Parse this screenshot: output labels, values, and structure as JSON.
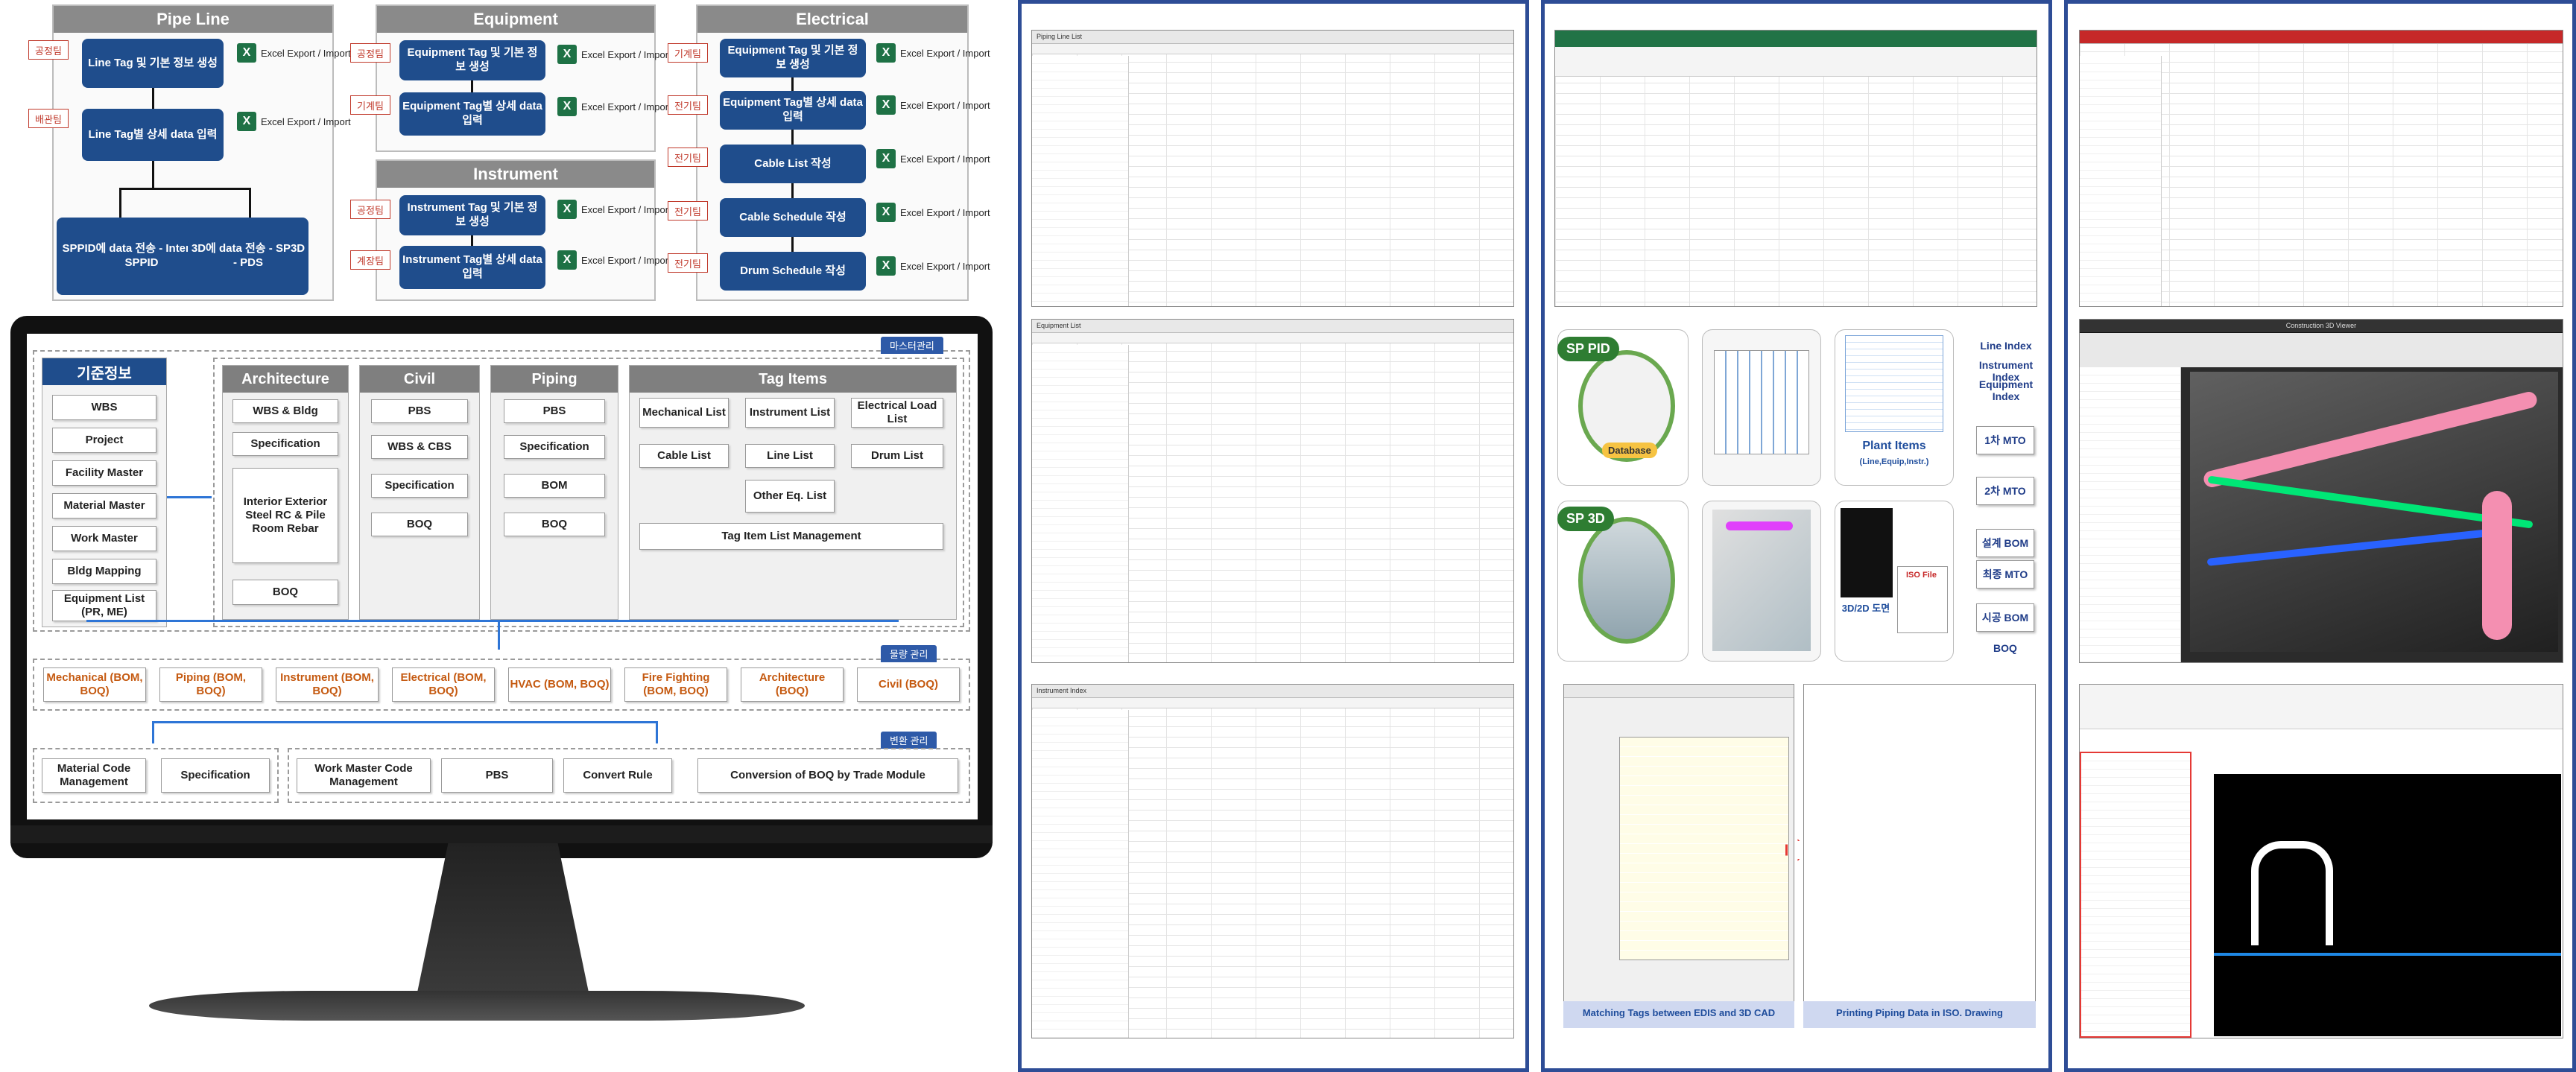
{
  "pipeline": {
    "title": "Pipe Line",
    "tag1": "공정팀",
    "tag2": "배관팀",
    "box1": "Line Tag 및 기본 정보 생성",
    "box2": "Line Tag별 상세 data 입력",
    "box3": "SPPID에 data 전송 - Intergraph SPPID",
    "box4": "3D에 data 전송 - SP3D - PDS",
    "xl_label": "Excel Export / Import"
  },
  "equipment": {
    "title": "Equipment",
    "tag1": "공정팀",
    "tag2": "기계팀",
    "box1": "Equipment Tag 및 기본 정보 생성",
    "box2": "Equipment Tag별 상세 data 입력",
    "xl_label": "Excel Export / Import"
  },
  "instrument": {
    "title": "Instrument",
    "tag1": "공정팀",
    "tag2": "계장팀",
    "box1": "Instrument Tag 및 기본 정보 생성",
    "box2": "Instrument Tag별 상세 data 입력",
    "xl_label": "Excel Export / Import"
  },
  "electrical": {
    "title": "Electrical",
    "tags": [
      "기계팀",
      "전기팀",
      "전기팀",
      "전기팀",
      "전기팀"
    ],
    "boxes": [
      "Equipment Tag 및 기본 정보 생성",
      "Equipment Tag별 상세 data 입력",
      "Cable List 작성",
      "Cable Schedule 작성",
      "Drum Schedule 작성"
    ],
    "xl_label": "Excel Export / Import"
  },
  "monitor": {
    "badge_master": "마스터관리",
    "badge_material": "물량 관리",
    "badge_change": "변환 관리",
    "basic": {
      "title": "기준정보",
      "items": [
        "WBS",
        "Project",
        "Facility Master",
        "Material Master",
        "Work Master",
        "Bldg Mapping",
        "Equipment List (PR, ME)"
      ]
    },
    "architecture": {
      "title": "Architecture",
      "items": [
        "WBS & Bldg",
        "Specification",
        "Interior Exterior Steel RC & Pile Room Rebar",
        "BOQ"
      ]
    },
    "civil": {
      "title": "Civil",
      "items": [
        "PBS",
        "WBS & CBS",
        "Specification",
        "BOQ"
      ]
    },
    "piping": {
      "title": "Piping",
      "items": [
        "PBS",
        "Specification",
        "BOM",
        "BOQ"
      ]
    },
    "tagitems": {
      "title": "Tag Items",
      "items": [
        "Mechanical List",
        "Instrument List",
        "Electrical Load List",
        "Cable List",
        "Line List",
        "Drum List",
        "Other Eq. List"
      ],
      "footer": "Tag Item List Management"
    },
    "trades": [
      "Mechanical (BOM, BOQ)",
      "Piping (BOM, BOQ)",
      "Instrument (BOM, BOQ)",
      "Electrical (BOM, BOQ)",
      "HVAC (BOM, BOQ)",
      "Fire Fighting (BOM, BOQ)",
      "Architecture (BOQ)",
      "Civil (BOQ)"
    ],
    "conv": {
      "material_code": "Material Code Management",
      "spec": "Specification",
      "work_master": "Work Master Code Management",
      "pbs": "PBS",
      "rule": "Convert Rule",
      "boq": "Conversion of BOQ by Trade Module"
    }
  },
  "panel2": {
    "win1_title": "Piping Line List",
    "win2_title": "Equipment List",
    "win3_title": "Instrument Index"
  },
  "panel3": {
    "sp_pid": "SP PID",
    "sp_3d": "SP 3D",
    "database": "Database",
    "plant_items": "Plant Items",
    "plant_items_sub": "(Line,Equip,Instr.)",
    "drawing_3d2d": "3D/2D 도면",
    "iso_file": "ISO File",
    "steps": [
      "Line Index",
      "Instrument Index",
      "Equipment Index",
      "1차 MTO",
      "2차 MTO",
      "설계 BOM",
      "최종 MTO",
      "시공 BOM",
      "BOQ"
    ],
    "cap_matching": "Matching Tags between EDIS and 3D CAD",
    "cap_printing": "Printing Piping Data in ISO. Drawing"
  },
  "panel4": {
    "win2_title": "Construction 3D Viewer"
  }
}
